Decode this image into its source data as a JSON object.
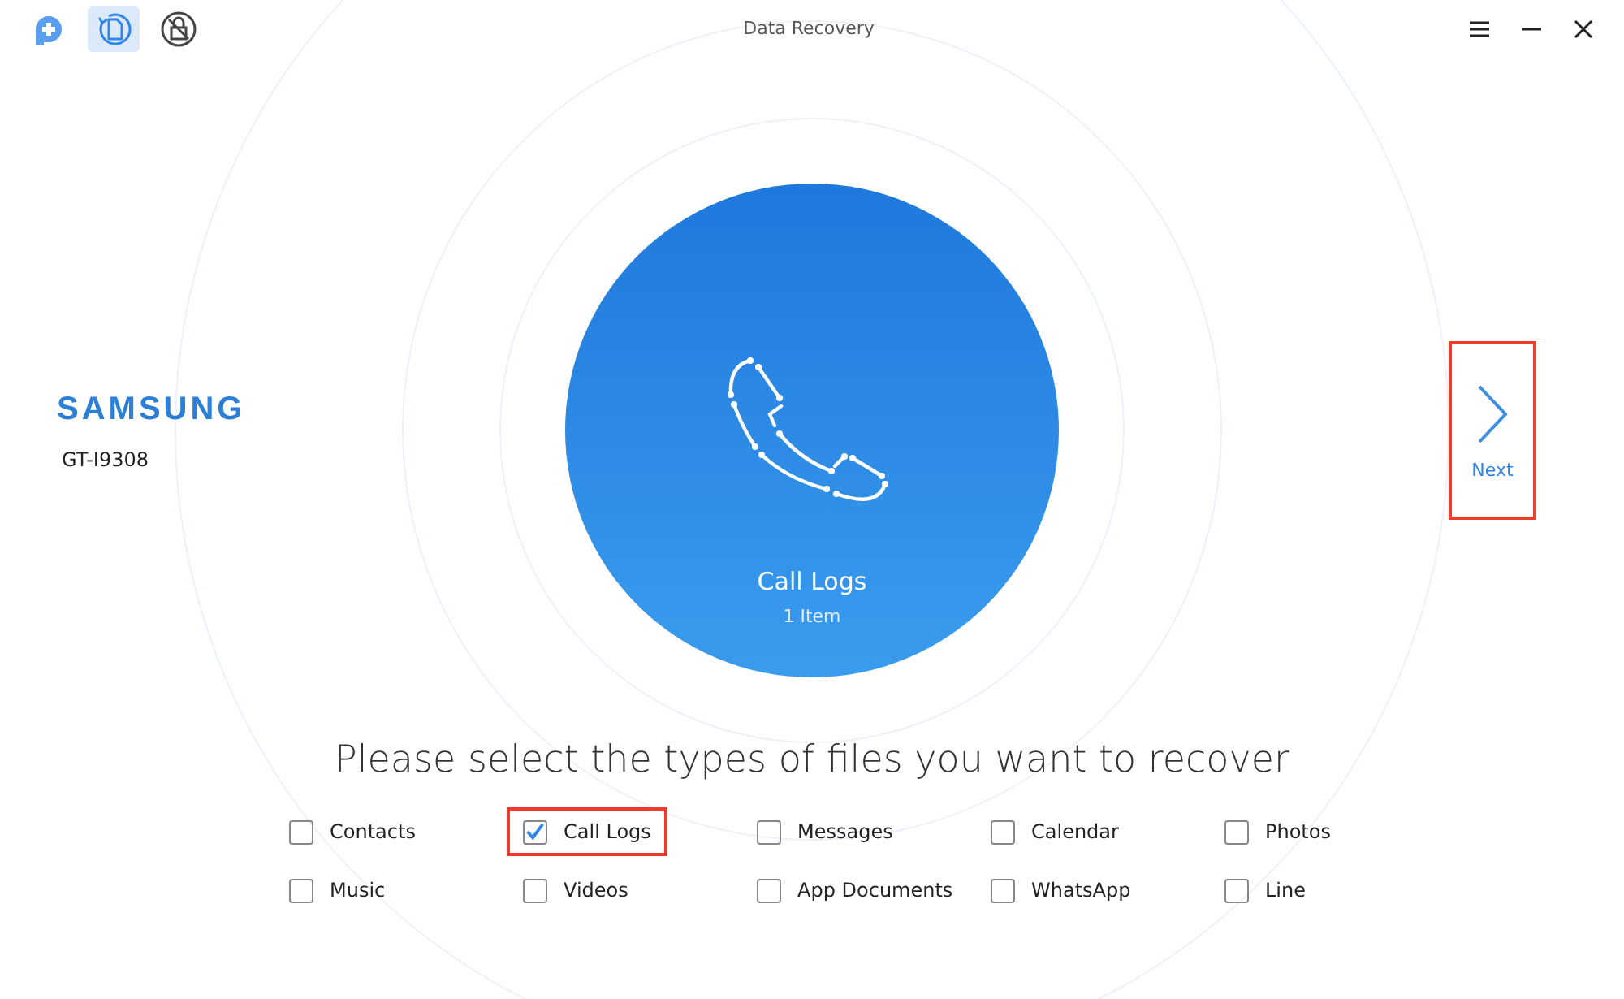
{
  "window": {
    "title": "Data Recovery"
  },
  "toolbar": [
    {
      "kind": "logo",
      "selected": false
    },
    {
      "kind": "recover",
      "selected": true
    },
    {
      "kind": "unlock",
      "selected": false
    }
  ],
  "device": {
    "brand": "SAMSUNG",
    "model": "GT-I9308"
  },
  "preview": {
    "title": "Call Logs",
    "count": "1 Item"
  },
  "next": {
    "label": "Next",
    "highlighted": true
  },
  "prompt": "Please select the types of files you want to recover",
  "file_types": [
    {
      "label": "Contacts",
      "checked": false,
      "highlighted": false
    },
    {
      "label": "Call Logs",
      "checked": true,
      "highlighted": true
    },
    {
      "label": "Messages",
      "checked": false,
      "highlighted": false
    },
    {
      "label": "Calendar",
      "checked": false,
      "highlighted": false
    },
    {
      "label": "Photos",
      "checked": false,
      "highlighted": false
    },
    {
      "label": "Music",
      "checked": false,
      "highlighted": false
    },
    {
      "label": "Videos",
      "checked": false,
      "highlighted": false
    },
    {
      "label": "App Documents",
      "checked": false,
      "highlighted": false
    },
    {
      "label": "WhatsApp",
      "checked": false,
      "highlighted": false
    },
    {
      "label": "Line",
      "checked": false,
      "highlighted": false
    }
  ]
}
